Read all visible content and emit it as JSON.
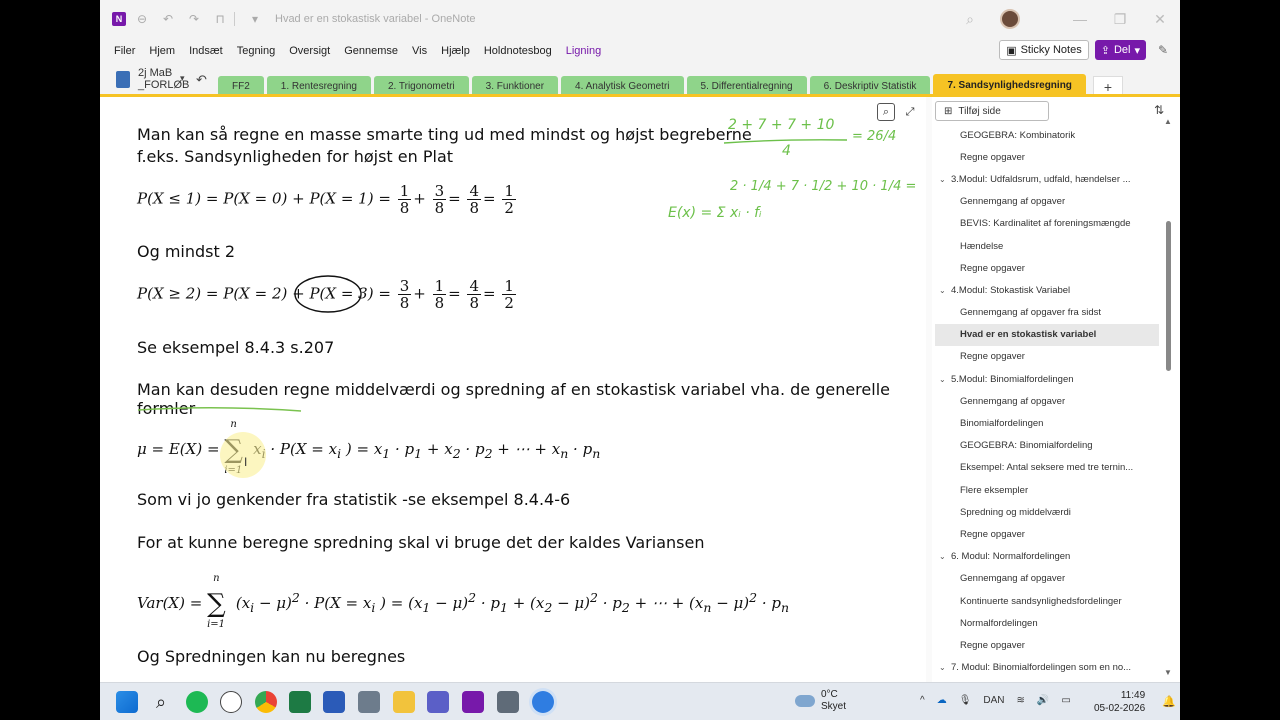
{
  "titlebar": {
    "title": "Hvad er en stokastisk variabel - OneNote",
    "logo": "N"
  },
  "menu": [
    "Filer",
    "Hjem",
    "Indsæt",
    "Tegning",
    "Oversigt",
    "Gennemse",
    "Vis",
    "Hjælp",
    "Holdnotesbog",
    "Ligning"
  ],
  "menu_right": {
    "sticky": "Sticky Notes",
    "share": "Del"
  },
  "notebook": {
    "line1": "2j MaB",
    "line2": "_FORLØB"
  },
  "tabs": [
    {
      "label": "FF2",
      "color": "#8fd48a"
    },
    {
      "label": "1. Rentesregning",
      "color": "#8fd48a"
    },
    {
      "label": "2. Trigonometri",
      "color": "#8fd48a"
    },
    {
      "label": "3. Funktioner",
      "color": "#8fd48a"
    },
    {
      "label": "4. Analytisk Geometri",
      "color": "#8fd48a"
    },
    {
      "label": "5. Differentialregning",
      "color": "#8fd48a"
    },
    {
      "label": "6. Deskriptiv Statistik",
      "color": "#8fd48a"
    },
    {
      "label": "7. Sandsynlighedsregning",
      "color": "#f6c324",
      "active": true
    }
  ],
  "content": {
    "cut_top": "g",
    "p1a": "Man kan så regne en masse smarte ting ud med mindst og højst begreberne",
    "p1b": "f.eks. Sandsynligheden for højst en Plat",
    "eq1": "P(X ≤ 1) = P(X = 0) + P(X = 1) =",
    "p2": "Og mindst 2",
    "eq2": "P(X ≥ 2) = P(X = 2) + P(X = 3) =",
    "p3": "Se eksempel 8.4.3 s.207",
    "p4": "Man kan desuden regne middelværdi og spredning af en stokastisk variabel vha. de generelle formler",
    "eq3a": "μ = E(X) =",
    "eq3b": "x",
    "eq3c": "· P(X = x",
    "eq3d": ") = x",
    "eq3e": "· p",
    "eq3f": "+ x",
    "eq3g": "+ ⋯ + x",
    "p5": "Som vi jo genkender fra statistik -se eksempel 8.4.4-6",
    "p6": "For at kunne beregne spredning skal vi bruge det der kaldes Variansen",
    "eq4": "Var(X) =",
    "eq4b": "(x",
    "eq4c": "− μ)",
    "eq4d": "· P(X = x",
    "eq4e": ") = (x",
    "eq4f": "+ (x",
    "eq4g": "+ ⋯ + (x",
    "p7": "Og Spredningen kan nu beregnes",
    "handwriting": {
      "h1": "2 + 7 + 7 + 10",
      "h2": "4",
      "h3": "= 26/4",
      "h4": "2 · 1/4 + 7 · 1/2 + 10 · 1/4 =",
      "h5": "E(x) = Σ xᵢ · fᵢ"
    }
  },
  "pages": {
    "add_label": "Tilføj side",
    "items": [
      {
        "label": "GEOGEBRA: Kombinatorik",
        "type": "sub"
      },
      {
        "label": "Regne opgaver",
        "type": "sub"
      },
      {
        "label": "3.Modul: Udfaldsrum, udfald, hændelser ...",
        "type": "grp"
      },
      {
        "label": "Gennemgang af opgaver",
        "type": "sub"
      },
      {
        "label": "BEVIS: Kardinalitet af foreningsmængde",
        "type": "sub"
      },
      {
        "label": "Hændelse",
        "type": "sub"
      },
      {
        "label": "Regne opgaver",
        "type": "sub"
      },
      {
        "label": "4.Modul: Stokastisk Variabel",
        "type": "grp"
      },
      {
        "label": "Gennemgang af opgaver fra sidst",
        "type": "sub"
      },
      {
        "label": "Hvad er en stokastisk variabel",
        "type": "sub",
        "active": true
      },
      {
        "label": "Regne opgaver",
        "type": "sub"
      },
      {
        "label": "5.Modul: Binomialfordelingen",
        "type": "grp"
      },
      {
        "label": "Gennemgang af opgaver",
        "type": "sub"
      },
      {
        "label": "Binomialfordelingen",
        "type": "sub"
      },
      {
        "label": "GEOGEBRA: Binomialfordeling",
        "type": "sub"
      },
      {
        "label": "Eksempel: Antal seksere med tre ternin...",
        "type": "sub"
      },
      {
        "label": "Flere eksempler",
        "type": "sub"
      },
      {
        "label": "Spredning og middelværdi",
        "type": "sub"
      },
      {
        "label": "Regne opgaver",
        "type": "sub"
      },
      {
        "label": "6. Modul: Normalfordelingen",
        "type": "grp"
      },
      {
        "label": "Gennemgang af opgaver",
        "type": "sub"
      },
      {
        "label": "Kontinuerte sandsynlighedsfordelinger",
        "type": "sub"
      },
      {
        "label": "Normalfordelingen",
        "type": "sub"
      },
      {
        "label": "Regne opgaver",
        "type": "sub"
      },
      {
        "label": "7. Modul: Binomialfordelingen som en no...",
        "type": "grp"
      }
    ]
  },
  "taskbar": {
    "weather_temp": "0°C",
    "weather_desc": "Skyet",
    "lang": "DAN",
    "time": "11:49",
    "date": "05-02-2026"
  }
}
